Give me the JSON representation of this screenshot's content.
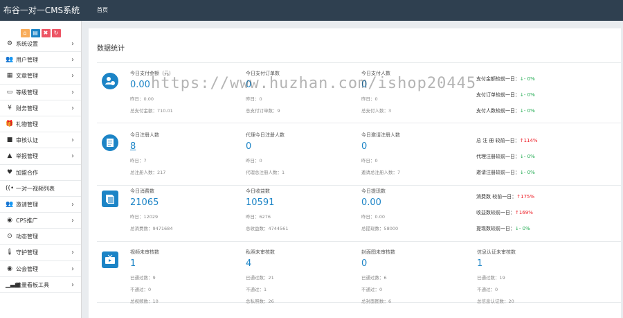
{
  "app": {
    "title": "布谷一对一CMS系统",
    "nav_home": "首页"
  },
  "quick_icons": [
    "home-icon",
    "file-icon",
    "trash-icon",
    "refresh-icon"
  ],
  "sidebar": {
    "items": [
      {
        "label": "系统设置",
        "icon": "gears-icon",
        "glyph": "⚙",
        "chev": "›"
      },
      {
        "label": "用户管理",
        "icon": "users-icon",
        "glyph": "👥",
        "chev": "›"
      },
      {
        "label": "文章管理",
        "icon": "grid-icon",
        "glyph": "▦",
        "chev": "›"
      },
      {
        "label": "等级管理",
        "icon": "monitor-icon",
        "glyph": "▭",
        "chev": "›"
      },
      {
        "label": "财务管理",
        "icon": "yen-icon",
        "glyph": "¥",
        "chev": "›"
      },
      {
        "label": "礼物管理",
        "icon": "gift-icon",
        "glyph": "🎁",
        "chev": ""
      },
      {
        "label": "审核认证",
        "icon": "video-icon",
        "glyph": "■",
        "chev": "›"
      },
      {
        "label": "举报管理",
        "icon": "warning-icon",
        "glyph": "▲",
        "chev": "›"
      },
      {
        "label": "加盟合作",
        "icon": "heart-icon",
        "glyph": "♥",
        "chev": ""
      },
      {
        "label": "一对一视频列表",
        "icon": "broadcast-icon",
        "glyph": "((•",
        "chev": ""
      },
      {
        "label": "邀请管理",
        "icon": "group-icon",
        "glyph": "👥",
        "chev": "›"
      },
      {
        "label": "CPS推广",
        "icon": "eye-icon",
        "glyph": "◉",
        "chev": "›"
      },
      {
        "label": "动态管理",
        "icon": "compass-icon",
        "glyph": "⊙",
        "chev": ""
      },
      {
        "label": "守护管理",
        "icon": "thermometer-icon",
        "glyph": "🌡",
        "chev": "›"
      },
      {
        "label": "公会管理",
        "icon": "eye-icon",
        "glyph": "◉",
        "chev": "›"
      },
      {
        "label": "流量看板工具",
        "icon": "signal-icon",
        "glyph": "▁▃▅",
        "chev": "›"
      }
    ]
  },
  "panel": {
    "title": "数据统计"
  },
  "watermark": "https://www.huzhan.com/ishop20445",
  "colors": {
    "accent": "#1c84c6",
    "up": "#ed1c24",
    "down": "#1aa84c",
    "icon": "#1c84c6"
  },
  "rows": [
    {
      "icon": "money-user-icon",
      "cols": [
        {
          "title": "今日支付金额（元）",
          "value": "0.00",
          "yesterday": "昨日：0.00",
          "total": "总支付金额：710.01"
        },
        {
          "title": "今日支付订单数",
          "value": "0",
          "yesterday": "昨日：0",
          "total": "总支付订单数：9"
        },
        {
          "title": "今日支付人数",
          "value": "0",
          "yesterday": "昨日：0",
          "total": "总支付人数：3"
        }
      ],
      "compare": [
        {
          "label": "支付金额较前一日：",
          "arrow": "↓",
          "value": "- 0%",
          "dir": "down"
        },
        {
          "label": "支付订单较前一日：",
          "arrow": "↓",
          "value": "- 0%",
          "dir": "down"
        },
        {
          "label": "支付人数较前一日：",
          "arrow": "↓",
          "value": "- 0%",
          "dir": "down"
        }
      ]
    },
    {
      "icon": "clipboard-icon",
      "cols": [
        {
          "title": "今日注册人数",
          "value": "8",
          "yesterday": "昨日：7",
          "total": "总注册人数：217",
          "link": true
        },
        {
          "title": "代理今日注册人数",
          "value": "0",
          "yesterday": "昨日：0",
          "total": "代理总注册人数：1"
        },
        {
          "title": "今日邀请注册人数",
          "value": "0",
          "yesterday": "昨日：0",
          "total": "邀请总注册人数：7"
        }
      ],
      "compare": [
        {
          "label": "总 注 册 较前一日：",
          "arrow": "↑",
          "value": "114%",
          "dir": "up"
        },
        {
          "label": "代理注册较前一日：",
          "arrow": "↓",
          "value": "- 0%",
          "dir": "down"
        },
        {
          "label": "邀请注册较前一日：",
          "arrow": "↓",
          "value": "- 0%",
          "dir": "down"
        }
      ]
    },
    {
      "icon": "book-icon",
      "cols": [
        {
          "title": "今日消费数",
          "value": "21065",
          "yesterday": "昨日：12029",
          "total": "总消费数：9471684"
        },
        {
          "title": "今日收益数",
          "value": "10591",
          "yesterday": "昨日：6276",
          "total": "总收益数：4744561"
        },
        {
          "title": "今日提现数",
          "value": "0.00",
          "yesterday": "昨日：0.00",
          "total": "总提现数：58000"
        }
      ],
      "compare": [
        {
          "label": "消费数 较前一日：",
          "arrow": "↑",
          "value": "175%",
          "dir": "up"
        },
        {
          "label": "收益数较前一日：",
          "arrow": "↑",
          "value": "169%",
          "dir": "up"
        },
        {
          "label": "提现数较前一日：",
          "arrow": "↓",
          "value": "- 0%",
          "dir": "down"
        }
      ]
    },
    {
      "icon": "tv-icon",
      "cols": [
        {
          "title": "视频未审核数",
          "value": "1",
          "yesterday": "已通过数：9",
          "total": "不通过：0",
          "extra": "总视频数：10"
        },
        {
          "title": "私照未审核数",
          "value": "4",
          "yesterday": "已通过数：21",
          "total": "不通过：1",
          "extra": "总私照数：26"
        },
        {
          "title": "封面图未审核数",
          "value": "0",
          "yesterday": "已通过数：6",
          "total": "不通过：0",
          "extra": "总封面图数：6"
        },
        {
          "title": "信息认证未审核数",
          "value": "1",
          "yesterday": "已通过数：19",
          "total": "不通过：0",
          "extra": "总信息认证数：20"
        }
      ]
    }
  ]
}
